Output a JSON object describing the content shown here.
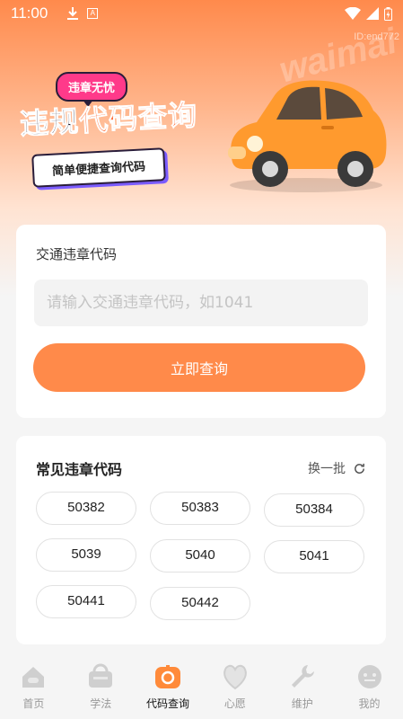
{
  "status": {
    "time": "11:00",
    "a_icon_letter": "A"
  },
  "watermark": {
    "id": "ID:end772",
    "brand": "waimai"
  },
  "banner": {
    "tag": "违章无忧",
    "headline_a": "违规",
    "headline_b": "代码查询",
    "subtitle": "简单便捷查询代码"
  },
  "query": {
    "label": "交通违章代码",
    "placeholder": "请输入交通违章代码，如1041",
    "value": "",
    "button": "立即查询"
  },
  "codes": {
    "title": "常见违章代码",
    "refresh_label": "换一批",
    "items": [
      "50382",
      "50383",
      "50384",
      "5039",
      "5040",
      "5041",
      "50441",
      "50442"
    ]
  },
  "tabs": [
    {
      "label": "首页",
      "icon": "home-icon",
      "active": false
    },
    {
      "label": "学法",
      "icon": "study-icon",
      "active": false
    },
    {
      "label": "代码查询",
      "icon": "code-query-icon",
      "active": true
    },
    {
      "label": "心愿",
      "icon": "wish-icon",
      "active": false
    },
    {
      "label": "维护",
      "icon": "wrench-icon",
      "active": false
    },
    {
      "label": "我的",
      "icon": "profile-icon",
      "active": false
    }
  ],
  "colors": {
    "accent": "#ff8a4a",
    "headline_highlight": "#ff5a1f",
    "tag_pink": "#ff3a8a"
  }
}
